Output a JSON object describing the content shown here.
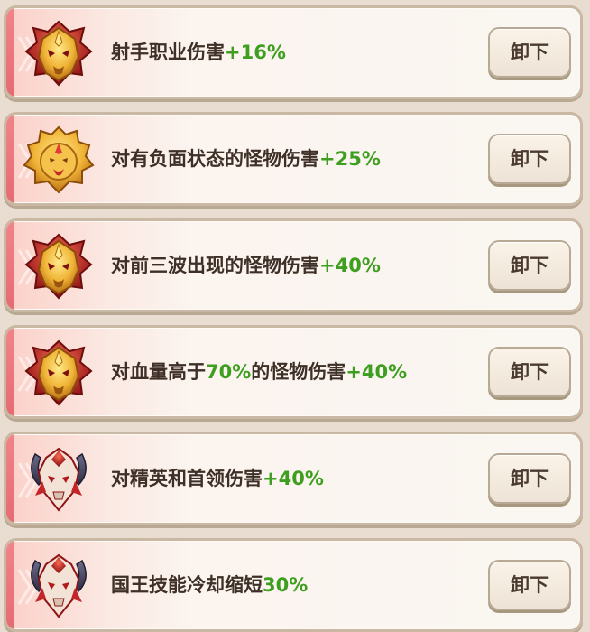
{
  "rows": [
    {
      "pre": "射手职业伤害",
      "mid": "",
      "post": "",
      "bonus": "+16%",
      "icon": "gold-dragon-crest-icon",
      "button": "卸下"
    },
    {
      "pre": "对有负面状态的怪物伤害",
      "mid": "",
      "post": "",
      "bonus": "+25%",
      "icon": "gold-lion-crest-icon",
      "button": "卸下"
    },
    {
      "pre": "对前三波出现的怪物伤害",
      "mid": "",
      "post": "",
      "bonus": "+40%",
      "icon": "gold-dragon-crest-icon",
      "button": "卸下"
    },
    {
      "pre": "对血量高于",
      "mid": "70%",
      "post": "的怪物伤害",
      "bonus": "+40%",
      "icon": "gold-dragon-crest-icon",
      "button": "卸下"
    },
    {
      "pre": "对精英和首领伤害",
      "mid": "",
      "post": "",
      "bonus": "+40%",
      "icon": "horned-skull-crest-icon",
      "button": "卸下"
    },
    {
      "pre": "国王技能冷却缩短",
      "mid": "",
      "post": "",
      "bonus": "30%",
      "icon": "horned-skull-crest-icon",
      "button": "卸下"
    }
  ],
  "colors": {
    "highlight": "#3e9e1f",
    "text": "#3e2f27",
    "accent_left": "#e56b72"
  }
}
